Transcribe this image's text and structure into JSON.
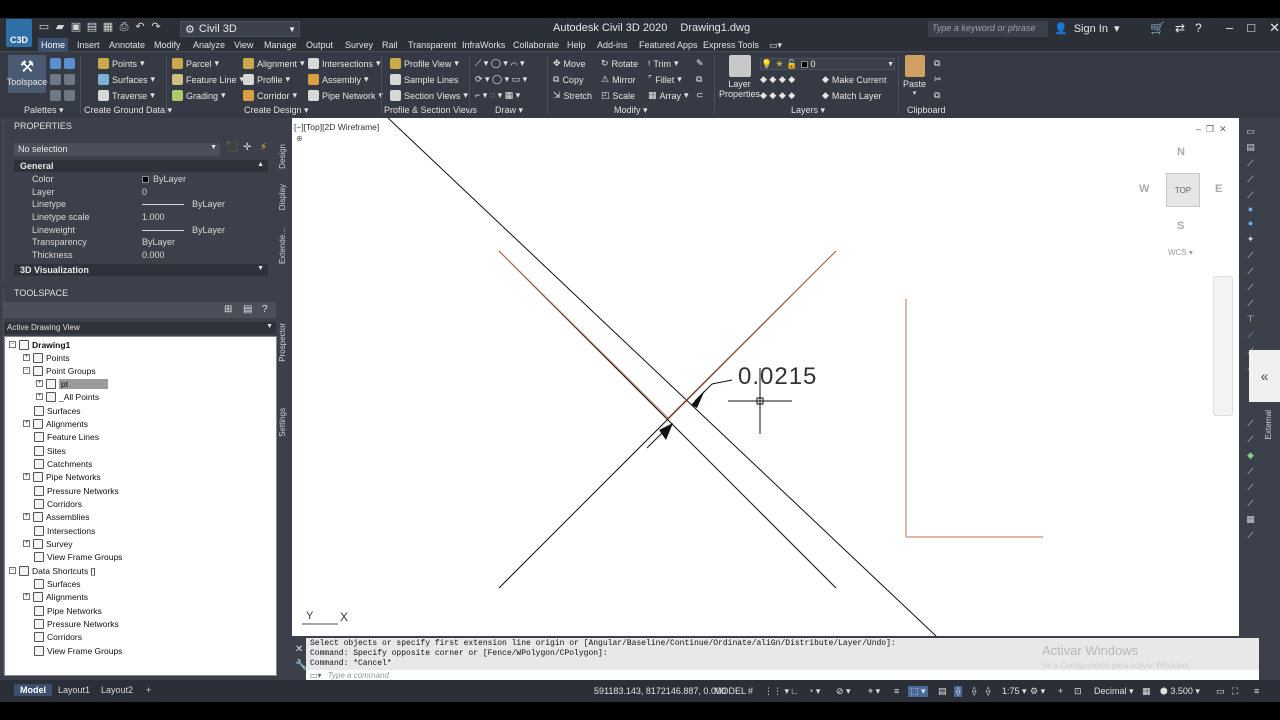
{
  "titlebar": {
    "app_badge": "C3D",
    "workspace": "Civil 3D",
    "app_name": "Autodesk Civil 3D 2020",
    "document": "Drawing1.dwg",
    "search_placeholder": "Type a keyword or phrase",
    "sign_in": "Sign In"
  },
  "ribbon_tabs": [
    "Home",
    "Insert",
    "Annotate",
    "Modify",
    "Analyze",
    "View",
    "Manage",
    "Output",
    "Survey",
    "Rail",
    "Transparent",
    "InfraWorks",
    "Collaborate",
    "Help",
    "Add-ins",
    "Featured Apps",
    "Express Tools"
  ],
  "ribbon": {
    "toolspace": "Toolspace",
    "points": "Points",
    "surfaces": "Surfaces",
    "traverse": "Traverse",
    "parcel": "Parcel",
    "feature_line": "Feature Line",
    "grading": "Grading",
    "alignment": "Alignment",
    "profile": "Profile",
    "corridor": "Corridor",
    "intersections": "Intersections",
    "assembly": "Assembly",
    "pipe_network": "Pipe Network",
    "profile_view": "Profile View",
    "sample_lines": "Sample Lines",
    "section_views": "Section Views",
    "move": "Move",
    "copy": "Copy",
    "stretch": "Stretch",
    "rotate": "Rotate",
    "mirror": "Mirror",
    "scale": "Scale",
    "trim": "Trim",
    "fillet": "Fillet",
    "array": "Array",
    "layer_properties_1": "Layer",
    "layer_properties_2": "Properties",
    "current_layer": "0",
    "make_current": "Make Current",
    "match_layer": "Match Layer",
    "paste": "Paste",
    "panels": {
      "palettes": "Palettes",
      "create_ground_data": "Create Ground Data",
      "create_design": "Create Design",
      "profile_section_views": "Profile & Section Views",
      "draw": "Draw",
      "modify": "Modify",
      "layers": "Layers",
      "clipboard": "Clipboard"
    }
  },
  "properties": {
    "header": "PROPERTIES",
    "selection": "No selection",
    "general": "General",
    "visualization": "3D Visualization",
    "rows": [
      {
        "label": "Color",
        "value": "ByLayer"
      },
      {
        "label": "Layer",
        "value": "0"
      },
      {
        "label": "Linetype",
        "value": "ByLayer"
      },
      {
        "label": "Linetype scale",
        "value": "1.000"
      },
      {
        "label": "Lineweight",
        "value": "ByLayer"
      },
      {
        "label": "Transparency",
        "value": "ByLayer"
      },
      {
        "label": "Thickness",
        "value": "0.000"
      }
    ],
    "side_tabs": [
      "Design",
      "Display",
      "Extende..."
    ]
  },
  "toolspace": {
    "header": "TOOLSPACE",
    "view": "Active Drawing View",
    "side_tabs": [
      "Prospector",
      "Settings"
    ],
    "tree": [
      {
        "label": "Drawing1",
        "bold": true
      },
      {
        "label": "Points"
      },
      {
        "label": "Point Groups"
      },
      {
        "label": "pt",
        "selected": true
      },
      {
        "label": "_All Points"
      },
      {
        "label": "Surfaces"
      },
      {
        "label": "Alignments"
      },
      {
        "label": "Feature Lines"
      },
      {
        "label": "Sites"
      },
      {
        "label": "Catchments"
      },
      {
        "label": "Pipe Networks"
      },
      {
        "label": "Pressure Networks"
      },
      {
        "label": "Corridors"
      },
      {
        "label": "Assemblies"
      },
      {
        "label": "Intersections"
      },
      {
        "label": "Survey"
      },
      {
        "label": "View Frame Groups"
      },
      {
        "label": "Data Shortcuts []"
      },
      {
        "label": "Surfaces"
      },
      {
        "label": "Alignments"
      },
      {
        "label": "Pipe Networks"
      },
      {
        "label": "Pressure Networks"
      },
      {
        "label": "Corridors"
      },
      {
        "label": "View Frame Groups"
      }
    ]
  },
  "canvas": {
    "view_label": "[−][Top][2D Wireframe]",
    "dimension_text": "0.0215",
    "viewcube_top": "TOP",
    "compass": {
      "n": "N",
      "s": "S",
      "e": "E",
      "w": "W"
    },
    "wcs": "WCS",
    "ucs_y": "Y",
    "ucs_x": "X"
  },
  "right_strip": {
    "external": "External"
  },
  "command": {
    "lines": [
      "Select objects or specify first extension line origin or [Angular/Baseline/Continue/Ordinate/aliGn/Distribute/Layer/Undo]:",
      "Command: Specify opposite corner or [Fence/WPolygon/CPolygon]:",
      "Command: *Cancel*"
    ],
    "placeholder": "Type a command",
    "watermark": "Activar Windows",
    "watermark_sub": "Ve a Configuración para activar Windows."
  },
  "statusbar": {
    "tabs": [
      "Model",
      "Layout1",
      "Layout2"
    ],
    "add_tab": "+",
    "coords": "591183.143, 8172146.887, 0.000",
    "mode": "MODEL",
    "scale": "1:75",
    "units": "Decimal",
    "annotation_value": "3.500"
  }
}
